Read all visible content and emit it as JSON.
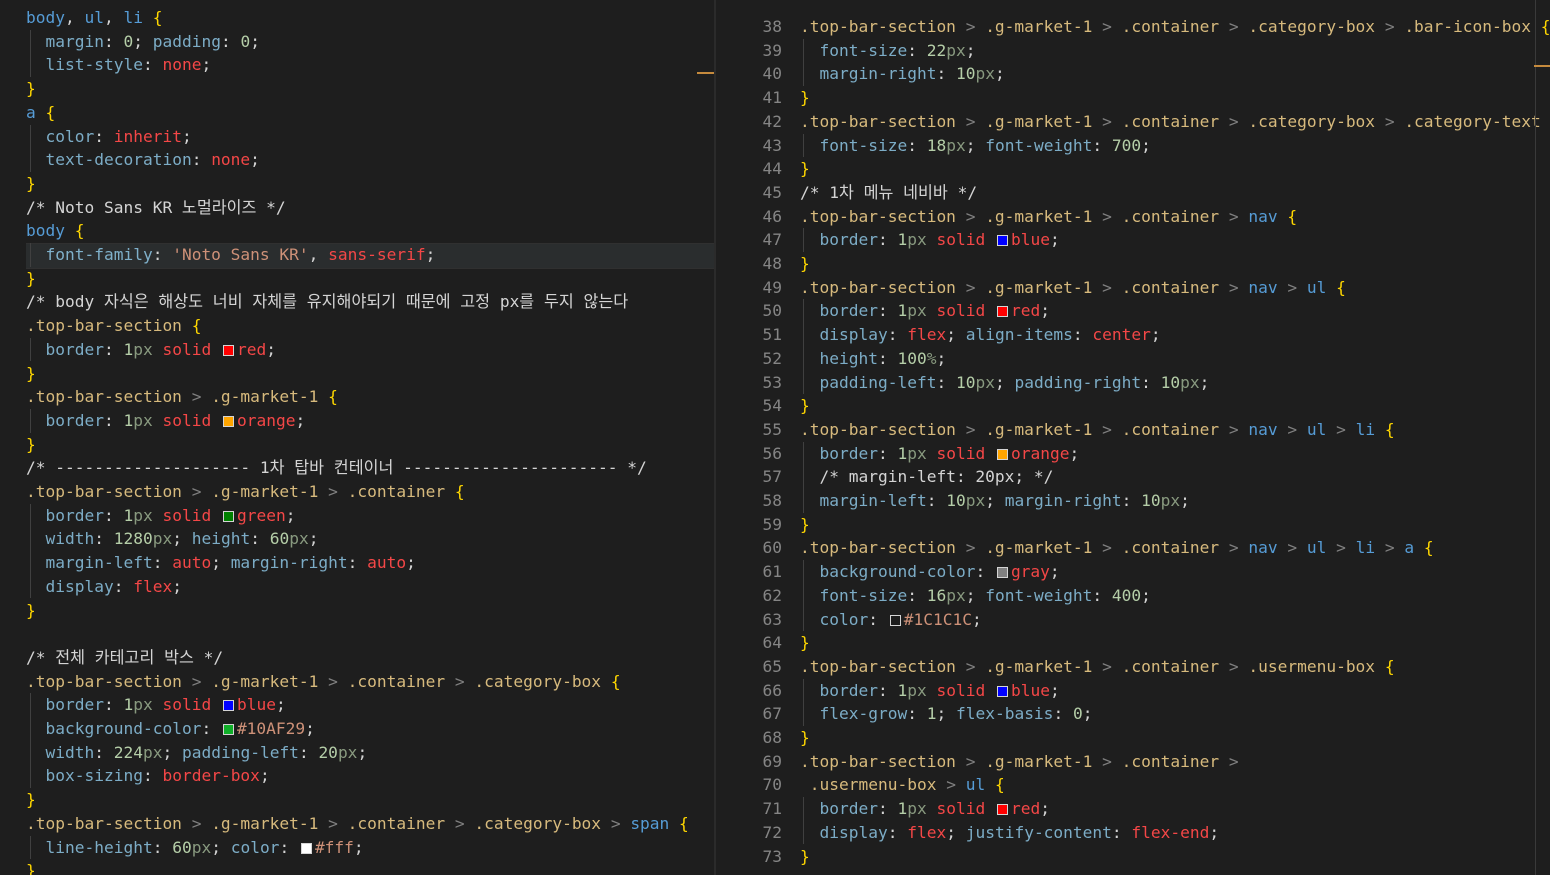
{
  "editor": {
    "left_lines": [
      "body, ul, li {",
      "  margin: 0; padding: 0;",
      "  list-style: none;",
      "}",
      "a {",
      "  color: inherit;",
      "  text-decoration: none;",
      "}",
      "/* Noto Sans KR 노멀라이즈 */",
      "body {",
      "  font-family: 'Noto Sans KR', sans-serif;",
      "}",
      "/* body 자식은 해상도 너비 자체를 유지해야되기 때문에 고정 px를 두지 않는다",
      ".top-bar-section {",
      "  border: 1px solid red;",
      "}",
      ".top-bar-section > .g-market-1 {",
      "  border: 1px solid orange;",
      "}",
      "/* -------------------- 1차 탑바 컨테이너 ---------------------- */",
      ".top-bar-section > .g-market-1 > .container {",
      "  border: 1px solid green;",
      "  width: 1280px; height: 60px;",
      "  margin-left: auto; margin-right: auto;",
      "  display: flex;",
      "}",
      "",
      "/* 전체 카테고리 박스 */",
      ".top-bar-section > .g-market-1 > .container > .category-box {",
      "  border: 1px solid blue;",
      "  background-color: #10AF29;",
      "  width: 224px; padding-left: 20px;",
      "  box-sizing: border-box;",
      "}",
      ".top-bar-section > .g-market-1 > .container > .category-box > span {",
      "  line-height: 60px; color: #fff;",
      "}"
    ],
    "right_lines": [
      {
        "n": "38",
        "t": ".top-bar-section > .g-market-1 > .container > .category-box > .bar-icon-box {"
      },
      {
        "n": "39",
        "t": "  font-size: 22px;"
      },
      {
        "n": "40",
        "t": "  margin-right: 10px;"
      },
      {
        "n": "41",
        "t": "}"
      },
      {
        "n": "42",
        "t": ".top-bar-section > .g-market-1 > .container > .category-box > .category-text {"
      },
      {
        "n": "43",
        "t": "  font-size: 18px; font-weight: 700;"
      },
      {
        "n": "44",
        "t": "}"
      },
      {
        "n": "45",
        "t": "/* 1차 메뉴 네비바 */"
      },
      {
        "n": "46",
        "t": ".top-bar-section > .g-market-1 > .container > nav {"
      },
      {
        "n": "47",
        "t": "  border: 1px solid blue;"
      },
      {
        "n": "48",
        "t": "}"
      },
      {
        "n": "49",
        "t": ".top-bar-section > .g-market-1 > .container > nav > ul {"
      },
      {
        "n": "50",
        "t": "  border: 1px solid red;"
      },
      {
        "n": "51",
        "t": "  display: flex; align-items: center;"
      },
      {
        "n": "52",
        "t": "  height: 100%;"
      },
      {
        "n": "53",
        "t": "  padding-left: 10px; padding-right: 10px;"
      },
      {
        "n": "54",
        "t": "}"
      },
      {
        "n": "55",
        "t": ".top-bar-section > .g-market-1 > .container > nav > ul > li {"
      },
      {
        "n": "56",
        "t": "  border: 1px solid orange;"
      },
      {
        "n": "57",
        "t": "  /* margin-left: 20px; */"
      },
      {
        "n": "58",
        "t": "  margin-left: 10px; margin-right: 10px;"
      },
      {
        "n": "59",
        "t": "}"
      },
      {
        "n": "60",
        "t": ".top-bar-section > .g-market-1 > .container > nav > ul > li > a {"
      },
      {
        "n": "61",
        "t": "  background-color: gray;"
      },
      {
        "n": "62",
        "t": "  font-size: 16px; font-weight: 400;"
      },
      {
        "n": "63",
        "t": "  color: #1C1C1C;"
      },
      {
        "n": "64",
        "t": "}"
      },
      {
        "n": "65",
        "t": ".top-bar-section > .g-market-1 > .container > .usermenu-box {"
      },
      {
        "n": "66",
        "t": "  border: 1px solid blue;"
      },
      {
        "n": "67",
        "t": "  flex-grow: 1; flex-basis: 0;"
      },
      {
        "n": "68",
        "t": "}"
      },
      {
        "n": "69",
        "t": ".top-bar-section > .g-market-1 > .container >"
      },
      {
        "n": "70",
        "t": " .usermenu-box > ul {"
      },
      {
        "n": "71",
        "t": "  border: 1px solid red;"
      },
      {
        "n": "72",
        "t": "  display: flex; justify-content: flex-end;"
      },
      {
        "n": "73",
        "t": "}"
      }
    ]
  },
  "colors": {
    "red": "#ff0000",
    "orange": "#ffa500",
    "green": "#008000",
    "blue": "#0000ff",
    "gray": "#808080",
    "c10AF29": "#10AF29",
    "cfff": "#ffffff",
    "c1C1C1C": "#1C1C1C"
  }
}
